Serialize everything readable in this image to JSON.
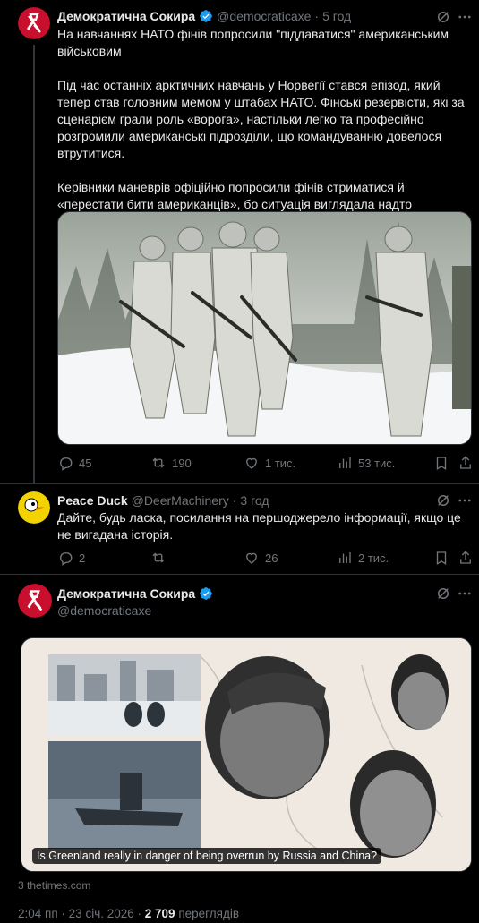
{
  "tweet1": {
    "author_name": "Демократична Сокира",
    "handle": "@democraticaxe",
    "time": "5 год",
    "paragraphs": [
      "На навчаннях НАТО фінів попросили \"піддаватися\" американським військовим",
      "Під час останніх арктичних навчань у Норвегії стався епізод, який тепер став головним мемом у штабах НАТО. Фінські резервісти, які за сценарієм грали роль «ворога», настільки легко та професійно розгромили американські підрозділи, що командуванню довелося втрутитися.",
      "Керівники маневрів офіційно попросили фінів стриматися й «перестати бити американців», бо ситуація виглядала надто принизливою та вщент деморалізувала солдатів США."
    ],
    "replies": "45",
    "reposts": "190",
    "likes": "1 тис.",
    "views": "53 тис."
  },
  "tweet2": {
    "author_name": "Peace Duck",
    "handle": "@DeerMachinery",
    "time": "3 год",
    "text": "Дайте, будь ласка, посилання на першоджерело інформації, якщо це не вигадана історія.",
    "replies": "2",
    "reposts": "",
    "likes": "26",
    "views": "2 тис."
  },
  "tweet3": {
    "author_name": "Демократична Сокира",
    "handle": "@democraticaxe",
    "card_caption": "Is Greenland really in danger of being overrun by Russia and China?",
    "card_source": "3 thetimes.com",
    "posted_time": "2:04 пп",
    "posted_date": "23 січ. 2026",
    "views_count": "2 709",
    "views_label": "переглядів"
  },
  "colors": {
    "background": "#000000",
    "text": "#e7e9ea",
    "muted": "#71767b",
    "verified": "#1d9bf0",
    "border": "#2f3336",
    "avatar_axe": "#c8102e",
    "avatar_duck": "#f2d300"
  },
  "icons": [
    "verified-badge-icon",
    "grok-icon",
    "more-icon",
    "reply-icon",
    "repost-icon",
    "like-icon",
    "views-icon",
    "bookmark-icon",
    "share-icon"
  ]
}
